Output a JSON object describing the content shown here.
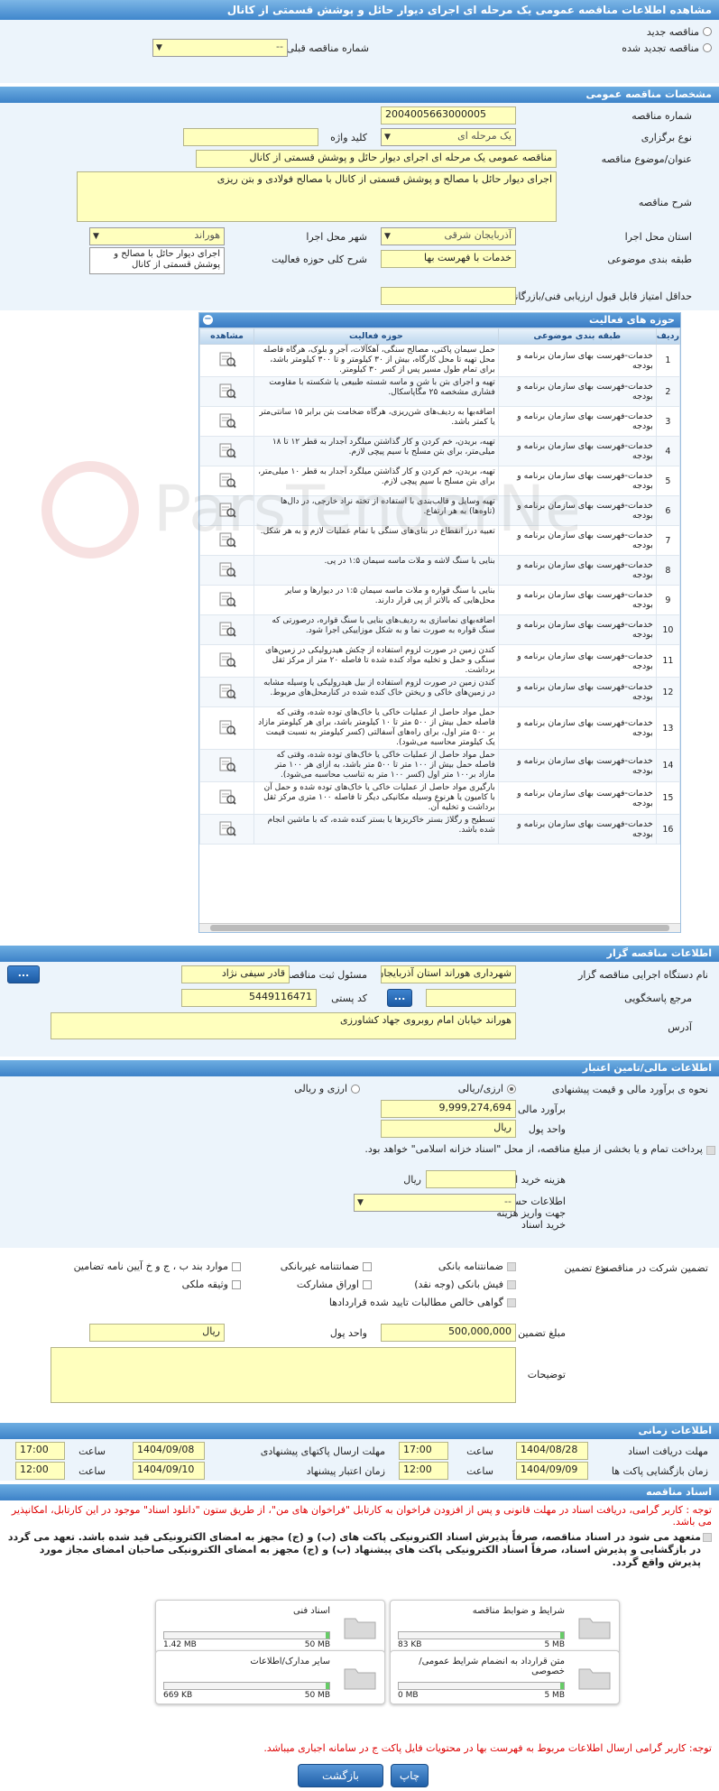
{
  "title": "مشاهده اطلاعات مناقصه عمومی یک مرحله ای اجرای دیوار حائل و پوشش قسمتی از کانال",
  "top": {
    "radio_new": "مناقصه جدید",
    "radio_renew": "مناقصه تجدید شده",
    "prev_label": "شماره مناقصه قبلی",
    "prev_value": "--"
  },
  "general": {
    "header": "مشخصات مناقصه عمومی",
    "number_label": "شماره مناقصه",
    "number": "2004005663000005",
    "type_label": "نوع برگزاری",
    "type": "یک مرحله ای",
    "keyword_label": "کلید واژه",
    "subject_label": "عنوان/موضوع مناقصه",
    "subject": "مناقصه عمومی یک مرحله ای اجرای دیوار حائل و پوشش قسمتی از کانال",
    "desc_label": "شرح مناقصه",
    "desc": "اجرای دیوار حائل با مصالح  و پوشش قسمتی از کانال با مصالح فولادی و بتن ریزی",
    "province_label": "استان محل اجرا",
    "province": "آذربایجان شرقی",
    "city_label": "شهر محل اجرا",
    "city": "هوراند",
    "category_label": "طبقه بندی موضوعی",
    "category": "خدمات با فهرست بها",
    "scope_label": "شرح کلی حوزه فعالیت",
    "scope": "اجرای دیوار حائل با مصالح و پوشش قسمتی از کانال",
    "score_label": "حداقل امتیاز قابل قبول ارزیابی فنی/بازرگانی"
  },
  "activity": {
    "header": "حوزه های فعالیت",
    "cols": [
      "ردیف",
      "طبقه بندی موضوعی",
      "حوزه فعالیت",
      "مشاهده"
    ],
    "rows": [
      {
        "n": "1",
        "cat": "خدمات-فهرست بهای سازمان برنامه و بودجه",
        "act": "حمل سیمان پاکتی، مصالح سنگی، آهکآلات، آجر و بلوک، هرگاه فاصله محل تهیه تا محل کارگاه، بیش از ۳۰ کیلومتر و تا ۳۰۰ کیلومتر باشد، برای تمام طول مسیر پس از کسر ۳۰ کیلومتر."
      },
      {
        "n": "2",
        "cat": "خدمات-فهرست بهای سازمان برنامه و بودجه",
        "act": "تهیه و اجرای بتن با شن و ماسه شسته طبیعی یا شکسته با مقاومت فشاری مشخصه ۲۵ مگاپاسکال."
      },
      {
        "n": "3",
        "cat": "خدمات-فهرست بهای سازمان برنامه و بودجه",
        "act": "اضافه‌بها به ردیف‌های شن‌ریزی، هرگاه ضخامت بتن برابر ۱۵ سانتی‌متر یا کمتر باشد."
      },
      {
        "n": "4",
        "cat": "خدمات-فهرست بهای سازمان برنامه و بودجه",
        "act": "تهیه، بریدن، خم کردن و کار گذاشتن میلگرد آجدار به قطر ۱۲ تا ۱۸ میلی‌متر، برای بتن مسلح با سیم پیچی لازم."
      },
      {
        "n": "5",
        "cat": "خدمات-فهرست بهای سازمان برنامه و بودجه",
        "act": "تهیه، بریدن، خم کردن و کار گذاشتن میلگرد آجدار به قطر ۱۰ میلی‌متر، برای بتن مسلح با سیم پیچی لازم."
      },
      {
        "n": "6",
        "cat": "خدمات-فهرست بهای سازمان برنامه و بودجه",
        "act": "تهیه وسایل و قالب‌بندی با استفاده از تخته نراد خارجی، در دال‌ها (تاوه‌ها) به هر ارتفاع."
      },
      {
        "n": "7",
        "cat": "خدمات-فهرست بهای سازمان برنامه و بودجه",
        "act": "تعبیه درز انقطاع در بنای‌های سنگی با تمام عملیات لازم و به هر شکل."
      },
      {
        "n": "8",
        "cat": "خدمات-فهرست بهای سازمان برنامه و بودجه",
        "act": "بنایی با سنگ لاشه و ملات ماسه سیمان ۱:۵ در پی."
      },
      {
        "n": "9",
        "cat": "خدمات-فهرست بهای سازمان برنامه و بودجه",
        "act": "بنایی با سنگ قواره و ملات ماسه سیمان ۱:۵ در دیوارها و سایر محل‌هایی که بالاتر از پی قرار دارند."
      },
      {
        "n": "10",
        "cat": "خدمات-فهرست بهای سازمان برنامه و بودجه",
        "act": "اضافه‌بهای نماسازی به ردیف‌های بنایی با سنگ قواره، درصورتی که سنگ قواره به صورت نما و به شکل موزاییکی اجرا شود."
      },
      {
        "n": "11",
        "cat": "خدمات-فهرست بهای سازمان برنامه و بودجه",
        "act": "کندن زمین در صورت لزوم استفاده از چکش هیدرولیکی در زمین‌های سنگی و حمل و تخلیه مواد کنده شده تا فاصله ۲۰ متر از مرکز ثقل برداشت."
      },
      {
        "n": "12",
        "cat": "خدمات-فهرست بهای سازمان برنامه و بودجه",
        "act": "کندن زمین در صورت لزوم استفاده از بیل هیدرولیکی یا وسیله مشابه در زمین‌های خاکی و ریختن خاک کنده شده در کنارمحل‌های مربوط."
      },
      {
        "n": "13",
        "cat": "خدمات-فهرست بهای سازمان برنامه و بودجه",
        "act": "حمل مواد حاصل از عملیات خاکی یا خاک‌های توده شده، وقتی که فاصله حمل بیش از ۵۰۰ متر تا ۱۰ کیلومتر باشد، برای هر کیلومتر مازاد بر ۵۰۰ متر اول، برای راه‌های آسفالتی (کسر کیلومتر به نسبت قیمت یک کیلومتر محاسبه می‌شود)."
      },
      {
        "n": "14",
        "cat": "خدمات-فهرست بهای سازمان برنامه و بودجه",
        "act": "حمل مواد حاصل از عملیات خاکی یا خاک‌های توده شده، وقتی که فاصله حمل بیش از ۱۰۰ متر تا ۵۰۰ متر باشد، به ازای هر ۱۰۰ متر مازاد بر۱۰۰ متر اول (کسر ۱۰۰ متر به تناسب محاسبه می‌شود)."
      },
      {
        "n": "15",
        "cat": "خدمات-فهرست بهای سازمان برنامه و بودجه",
        "act": "بارگیری مواد حاصل از عملیات خاکی یا خاک‌های توده شده و  حمل آن با کامیون یا هرنوع وسیله مکانیکی دیگر تا فاصله ۱۰۰ متری مرکز ثقل برداشت و تخلیه آن."
      },
      {
        "n": "16",
        "cat": "خدمات-فهرست بهای سازمان برنامه و بودجه",
        "act": "تسطیح و رگلاژ بستر خاکریزها یا بستر کنده شده، که با ماشین انجام شده باشد."
      }
    ]
  },
  "organizer": {
    "header": "اطلاعات مناقصه گزار",
    "org_label": "نام دستگاه اجرایی مناقصه گزار",
    "org": "شهرداری هوراند استان آذربایجان شرقی",
    "resp_label": "مسئول ثبت مناقصه",
    "resp": "قادر سیفی نژاد",
    "ref_label": "مرجع پاسخگویی",
    "postal_label": "کد پستی",
    "postal": "5449116471",
    "address_label": "آدرس",
    "address": "هوراند خیابان امام روبروی جهاد کشاورزی",
    "btn": "..."
  },
  "finance": {
    "header": "اطلاعات مالی/تامین اعتبار",
    "method_label": "نحوه ی برآورد مالی و قیمت پیشنهادی",
    "opt_rial": "ارزی/ریالی",
    "opt_both": "ارزی و ریالی",
    "estimate_label": "برآورد مالی",
    "estimate": "9,999,274,694",
    "unit_label": "واحد پول",
    "unit": "ریال",
    "pay_text": "پرداخت تمام و یا بخشی از مبلغ مناقصه، از محل \"اسناد خزانه اسلامی\" خواهد بود.",
    "doc_cost_label": "هزینه خرید اسناد",
    "doc_cost_unit": "ریال",
    "account_label": "اطلاعات حساب جهت واریز هزینه خرید اسناد",
    "account": "--"
  },
  "guarantee": {
    "label": "تضمین شرکت در مناقصه:",
    "type_label": "نوع تضمین",
    "opts": [
      "ضمانتنامه بانکی",
      "ضمانتنامه غیربانکی",
      "موارد بند ب ، ج و خ آیین نامه تضامین",
      "فیش بانکی (وجه نقد)",
      "اوراق مشارکت",
      "وثیقه ملکی",
      "گواهی خالص مطالبات تایید شده قراردادها"
    ],
    "amount_label": "مبلغ تضمین",
    "amount": "500,000,000",
    "unit_label": "واحد پول",
    "unit": "ریال",
    "notes_label": "توضیحات"
  },
  "time": {
    "header": "اطلاعات زمانی",
    "receive_label": "مهلت دریافت اسناد",
    "receive_date": "1404/08/28",
    "receive_time": "17:00",
    "send_label": "مهلت ارسال پاکتهای پیشنهادی",
    "send_date": "1404/09/08",
    "send_time": "17:00",
    "open_label": "زمان بازگشایی پاکت ها",
    "open_date": "1404/09/09",
    "open_time": "12:00",
    "valid_label": "زمان اعتبار پیشنهاد",
    "valid_date": "1404/09/10",
    "valid_time": "12:00",
    "hour": "ساعت"
  },
  "docs": {
    "header": "اسناد مناقصه",
    "note1": "توجه : کاربر گرامی، دریافت اسناد در مهلت قانونی و پس از افزودن فراخوان به کارتابل \"فراخوان های من\"، از طریق ستون \"دانلود اسناد\" موجود در این کارتابل، امکانپذیر می باشد.",
    "note2": "متعهد می شود در اسناد مناقصه، صرفاً پذیرش اسناد الکترونیکی پاکت های (ب) و (ج) مجهز به امضای الکترونیکی قید شده باشد. تعهد می گردد در بازگشایی و پذیرش اسناد، صرفاً اسناد الکترونیکی پاکت های پیشنهاد (ب) و (ج) مجهز به امضای الکترونیکی صاحبان امضای مجاز مورد پذیرش واقع گردد.",
    "files": [
      {
        "name": "شرایط و ضوابط مناقصه",
        "used": "83 KB",
        "max": "5 MB"
      },
      {
        "name": "اسناد فنی",
        "used": "1.42 MB",
        "max": "50 MB"
      },
      {
        "name": "متن قرارداد به انضمام شرایط عمومی/خصوصی",
        "used": "0 MB",
        "max": "5 MB"
      },
      {
        "name": "سایر مدارک/اطلاعات",
        "used": "669 KB",
        "max": "50 MB"
      }
    ],
    "note3": "توجه: کاربر گرامی ارسال اطلاعات مربوط به فهرست بها در محتویات فایل پاکت ج در سامانه اجباری میباشد."
  },
  "buttons": {
    "print": "چاپ",
    "back": "بازگشت"
  },
  "watermark": "ParsTenderNet"
}
